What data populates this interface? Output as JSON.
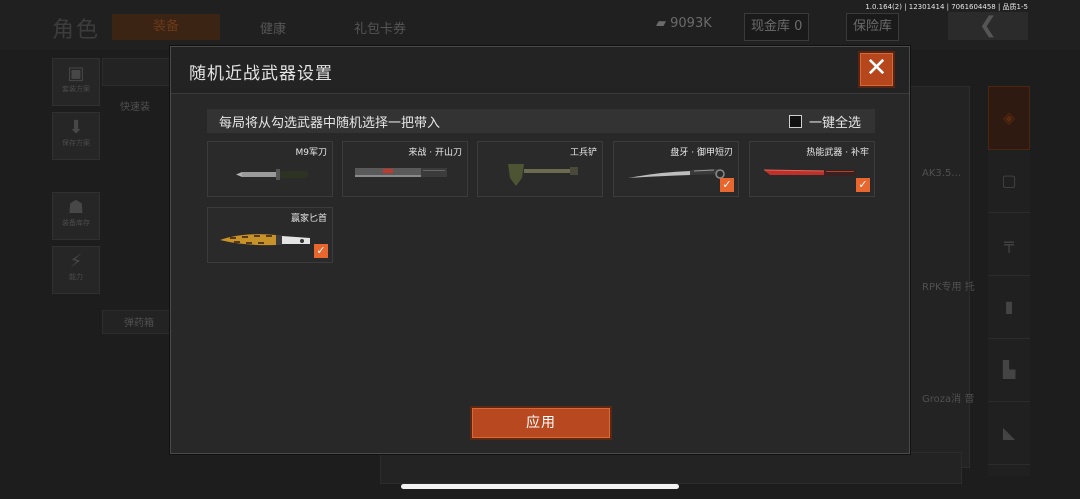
{
  "status": {
    "version": "1.0.164(2) | 12301414 | 7061604458 | 品质1-5"
  },
  "background": {
    "title": "角色",
    "tabs": [
      "装备",
      "健康",
      "礼包卡券"
    ],
    "money": "9093K",
    "cash_storage": "现金库 0",
    "insurance": "保险库",
    "side_buttons": [
      "套装方案",
      "保存方案",
      "装备库存",
      "能力"
    ],
    "quick_label": "快速装",
    "ammo_label": "弹药箱",
    "right_labels": [
      "AK3.5…",
      "RPK专用 托",
      "Groza消 音"
    ]
  },
  "modal": {
    "title": "随机近战武器设置",
    "notice": "每局将从勾选武器中随机选择一把带入",
    "select_all": "一键全选",
    "apply": "应用",
    "close_icon": "close-icon"
  },
  "weapons": [
    {
      "name": "M9军刀",
      "checked": false,
      "icon": "bayonet-icon"
    },
    {
      "name": "来战 · 开山刀",
      "checked": false,
      "icon": "machete-icon"
    },
    {
      "name": "工兵铲",
      "checked": false,
      "icon": "shovel-icon"
    },
    {
      "name": "盘牙 · 御甲短刃",
      "checked": true,
      "icon": "curved-dagger-icon"
    },
    {
      "name": "热能武器 · 补牢",
      "checked": true,
      "icon": "red-blade-icon"
    },
    {
      "name": "赢家匕首",
      "checked": true,
      "icon": "gold-dagger-icon"
    }
  ],
  "colors": {
    "accent": "#b8481f",
    "check": "#e8672f"
  }
}
